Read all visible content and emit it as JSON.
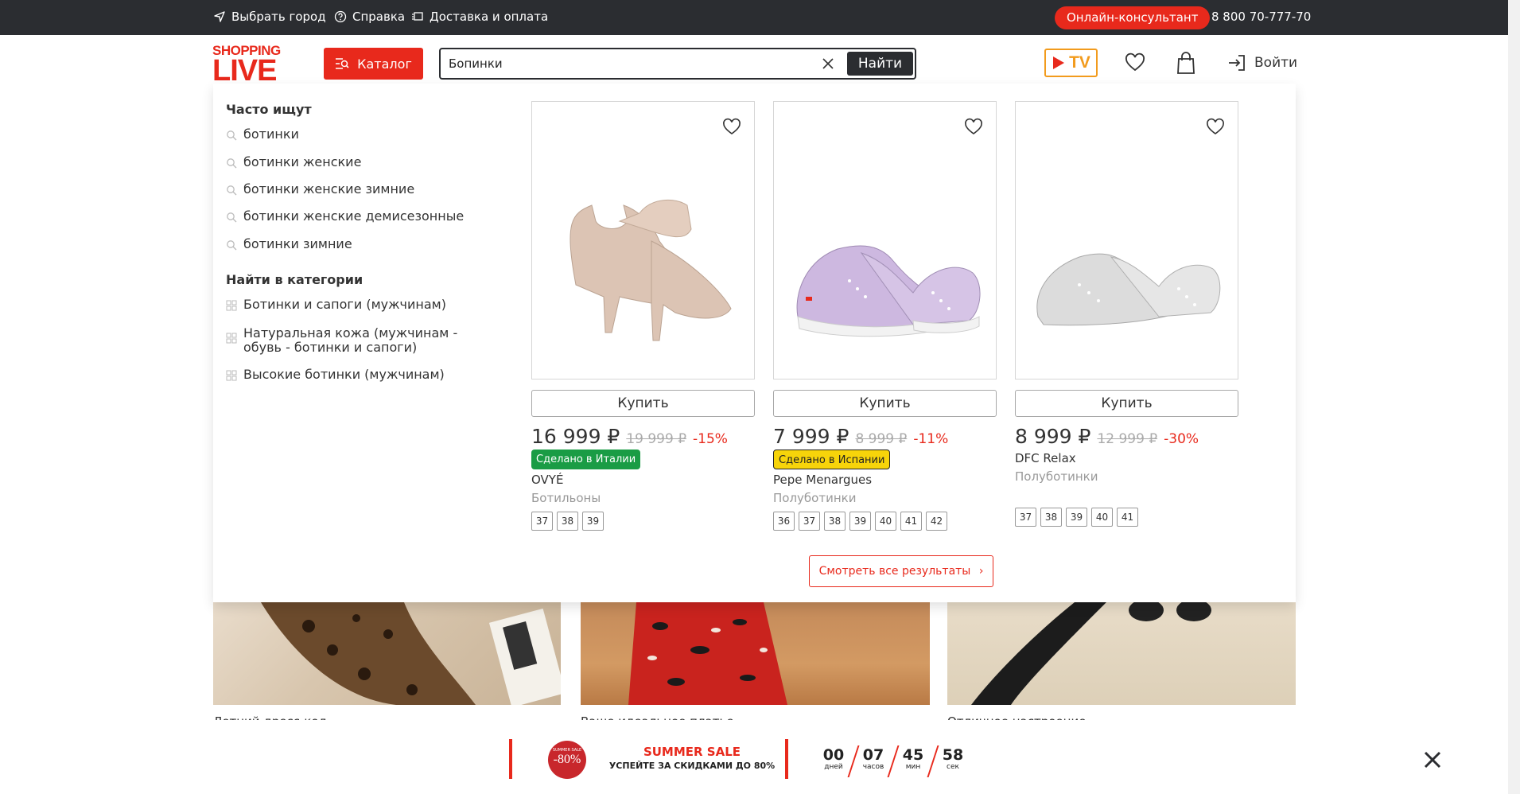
{
  "topbar": {
    "city": "Выбрать город",
    "help": "Справка",
    "delivery": "Доставка и оплата",
    "consultant": "Онлайн-консультант",
    "phone": "8 800 70-777-70"
  },
  "header": {
    "logo_line1": "SHOPPING",
    "logo_line2": "LIVE",
    "catalog": "Каталог",
    "search_value": "Бопинки",
    "search_button": "Найти",
    "tv_label": "TV",
    "login": "Войти"
  },
  "dropdown": {
    "frequent_title": "Часто ищут",
    "frequent": [
      "ботинки",
      "ботинки женские",
      "ботинки женские зимние",
      "ботинки женские демисезонные",
      "ботинки зимние"
    ],
    "category_title": "Найти в категории",
    "categories": [
      "Ботинки и сапоги (мужчинам)",
      "Натуральная кожа (мужчинам - обувь - ботинки и сапоги)",
      "Высокие ботинки (мужчинам)"
    ],
    "see_all": "Смотреть все результаты",
    "products": [
      {
        "buy": "Купить",
        "price": "16 999 ₽",
        "old_price": "19 999 ₽",
        "discount": "-15%",
        "badge": "Сделано в Италии",
        "brand": "OVYÉ",
        "category": "Ботильоны",
        "sizes": [
          "37",
          "38",
          "39"
        ]
      },
      {
        "buy": "Купить",
        "price": "7 999 ₽",
        "old_price": "8 999 ₽",
        "discount": "-11%",
        "badge": "Сделано в Испании",
        "brand": "Pepe Menargues",
        "category": "Полуботинки",
        "sizes": [
          "36",
          "37",
          "38",
          "39",
          "40",
          "41",
          "42"
        ]
      },
      {
        "buy": "Купить",
        "price": "8 999 ₽",
        "old_price": "12 999 ₽",
        "discount": "-30%",
        "brand": "DFC Relax",
        "category": "Полуботинки",
        "sizes": [
          "37",
          "38",
          "39",
          "40",
          "41"
        ]
      }
    ]
  },
  "banners": {
    "captions": [
      "Летний дресс-код",
      "Ваше идеальное платье",
      "Отличное настроение"
    ]
  },
  "sale": {
    "circle_small": "SUMMER SALE",
    "circle_big": "-80%",
    "title": "SUMMER SALE",
    "subtitle": "УСПЕЙТЕ ЗА СКИДКАМИ ДО 80%",
    "days": "00",
    "days_label": "дней",
    "hours": "07",
    "hours_label": "часов",
    "minutes": "45",
    "minutes_label": "мин",
    "seconds": "58",
    "seconds_label": "сек"
  },
  "colors": {
    "accent": "#e8291c",
    "dark": "#2b2d31",
    "tv": "#f29b1d",
    "green_badge": "#1a9c45",
    "yellow_badge": "#f7d40a"
  }
}
